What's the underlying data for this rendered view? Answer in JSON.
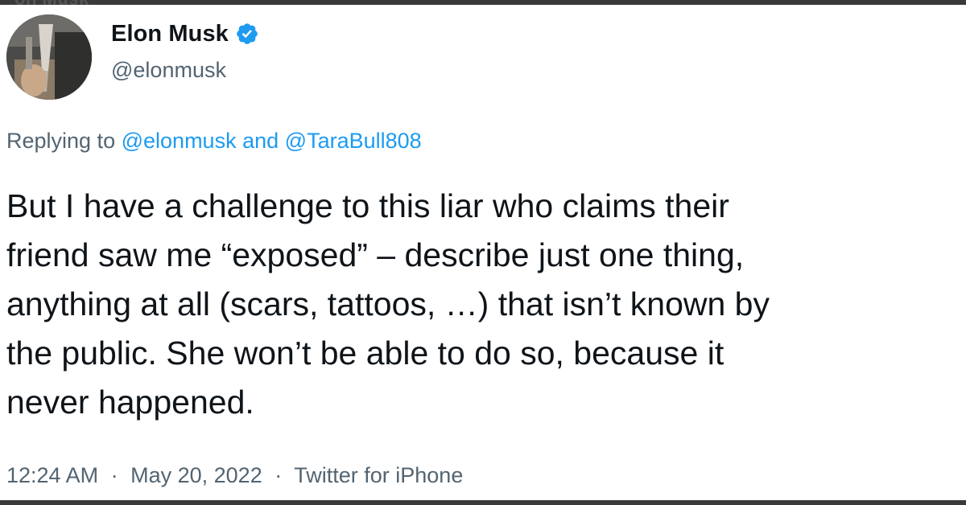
{
  "header_ghost_text": "on Musk",
  "author": {
    "display_name": "Elon Musk",
    "handle": "@elonmusk",
    "verified_icon": "verified-badge-icon",
    "verified_color": "#1d9bf0"
  },
  "reply": {
    "prefix": "Replying to",
    "mention_1": "@elonmusk",
    "joiner": "and",
    "mention_2": "@TaraBull808"
  },
  "tweet": {
    "lines": [
      "But I have a challenge to this liar who claims their",
      "friend saw me “exposed” – describe just one thing,",
      "anything at all (scars, tattoos, …) that isn’t known by",
      "the public. She won’t be able to do so, because it",
      "never happened."
    ]
  },
  "meta": {
    "time": "12:24 AM",
    "date": "May 20, 2022",
    "source": "Twitter for iPhone",
    "separator": "·"
  },
  "colors": {
    "text": "#0f1419",
    "secondary": "#536471",
    "link": "#1d9bf0",
    "frame_bar": "#3a3a3a"
  }
}
